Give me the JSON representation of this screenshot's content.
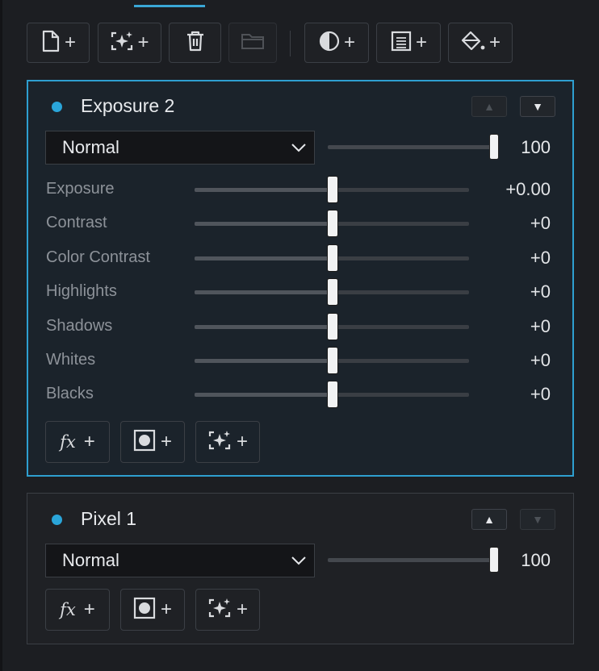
{
  "toolbar": {
    "buttons": [
      {
        "name": "new-layer-button",
        "icon": "new-page-icon",
        "plus": "+"
      },
      {
        "name": "new-ai-layer-button",
        "icon": "ai-sparkle-frame-icon",
        "plus": "+"
      },
      {
        "name": "delete-layer-button",
        "icon": "trash-icon"
      },
      {
        "name": "group-folder-button",
        "icon": "folder-icon"
      },
      {
        "name": "add-adjustment-button",
        "icon": "half-circle-icon",
        "plus": "+"
      },
      {
        "name": "add-text-layer-button",
        "icon": "text-frame-icon",
        "plus": "+"
      },
      {
        "name": "add-fill-layer-button",
        "icon": "paint-bucket-icon",
        "plus": "+"
      }
    ]
  },
  "layers": [
    {
      "title": "Exposure 2",
      "blend_mode": "Normal",
      "opacity": "100",
      "opacity_level": 1.0,
      "adjustments": [
        {
          "label": "Exposure",
          "value": "+0.00",
          "level": 0.5
        },
        {
          "label": "Contrast",
          "value": "+0",
          "level": 0.5
        },
        {
          "label": "Color Contrast",
          "value": "+0",
          "level": 0.5
        },
        {
          "label": "Highlights",
          "value": "+0",
          "level": 0.5
        },
        {
          "label": "Shadows",
          "value": "+0",
          "level": 0.5
        },
        {
          "label": "Whites",
          "value": "+0",
          "level": 0.5
        },
        {
          "label": "Blacks",
          "value": "+0",
          "level": 0.5
        }
      ],
      "footer": {
        "fx_label": "fx",
        "plus": "+"
      }
    },
    {
      "title": "Pixel 1",
      "blend_mode": "Normal",
      "opacity": "100",
      "opacity_level": 1.0,
      "footer": {
        "fx_label": "fx",
        "plus": "+"
      }
    }
  ],
  "colors": {
    "accent": "#2e9fd0",
    "dot": "#2aa5d9",
    "background": "#1c1e22"
  }
}
